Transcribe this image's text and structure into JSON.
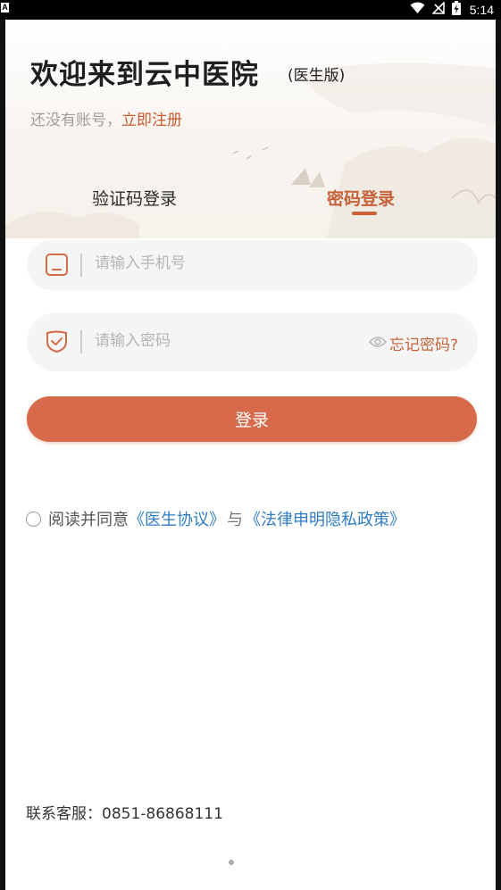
{
  "status_bar": {
    "notification_badge": "A",
    "time": "5:14"
  },
  "header": {
    "title": "欢迎来到云中医院",
    "edition": "(医生版)",
    "register_prompt": "还没有账号，",
    "register_link": "立即注册"
  },
  "tabs": [
    {
      "label": "验证码登录",
      "active": false
    },
    {
      "label": "密码登录",
      "active": true
    }
  ],
  "form": {
    "phone_placeholder": "请输入手机号",
    "password_placeholder": "请输入密码",
    "forgot_label": "忘记密码?",
    "login_label": "登录"
  },
  "agreement": {
    "prefix": "阅读并同意",
    "doctor_agreement": "《医生协议》",
    "conjunction": "与",
    "privacy_policy": "《法律申明隐私政策》",
    "checked": false
  },
  "footer": {
    "service_label": "联系客服：",
    "service_phone": "0851-86868111"
  },
  "colors": {
    "accent": "#d66a4a",
    "link_blue": "#2f7bc4",
    "tab_active": "#c6623a"
  }
}
